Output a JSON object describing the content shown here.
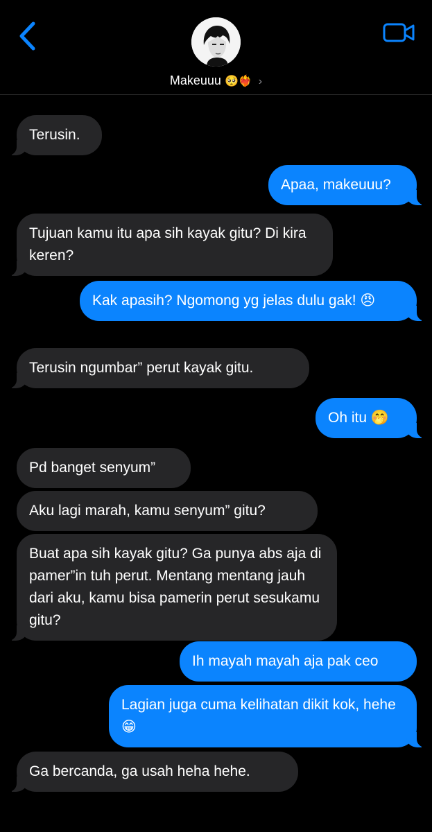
{
  "header": {
    "contact_name": "Makeuuu",
    "contact_emoji": "🥺❤️‍🔥",
    "chevron": "›",
    "back_icon": "chevron-left-icon",
    "video_icon": "video-camera-icon",
    "accent_color": "#0b84fe"
  },
  "messages": [
    {
      "dir": "in",
      "text": "Terusin."
    },
    {
      "dir": "out",
      "text": "Apaa, makeuuu?"
    },
    {
      "dir": "in",
      "text": "Tujuan kamu itu apa sih kayak gitu? Di kira keren?"
    },
    {
      "dir": "out",
      "text": "Kak apasih? Ngomong yg jelas dulu gak! 😠"
    },
    {
      "dir": "in",
      "text": "Terusin ngumbar” perut kayak gitu."
    },
    {
      "dir": "out",
      "text": "Oh itu 🤭"
    },
    {
      "dir": "in",
      "text": "Pd banget senyum”"
    },
    {
      "dir": "in",
      "text": "Aku lagi marah, kamu senyum” gitu?"
    },
    {
      "dir": "in",
      "text": "Buat apa sih kayak gitu? Ga punya abs aja di pamer”in tuh perut. Mentang mentang jauh dari aku, kamu bisa pamerin perut sesukamu gitu?"
    },
    {
      "dir": "out",
      "text": "Ih mayah mayah aja pak ceo"
    },
    {
      "dir": "out",
      "text": "Lagian juga cuma kelihatan dikit kok, hehe 😁"
    },
    {
      "dir": "in",
      "text": "Ga bercanda, ga usah heha hehe."
    }
  ]
}
